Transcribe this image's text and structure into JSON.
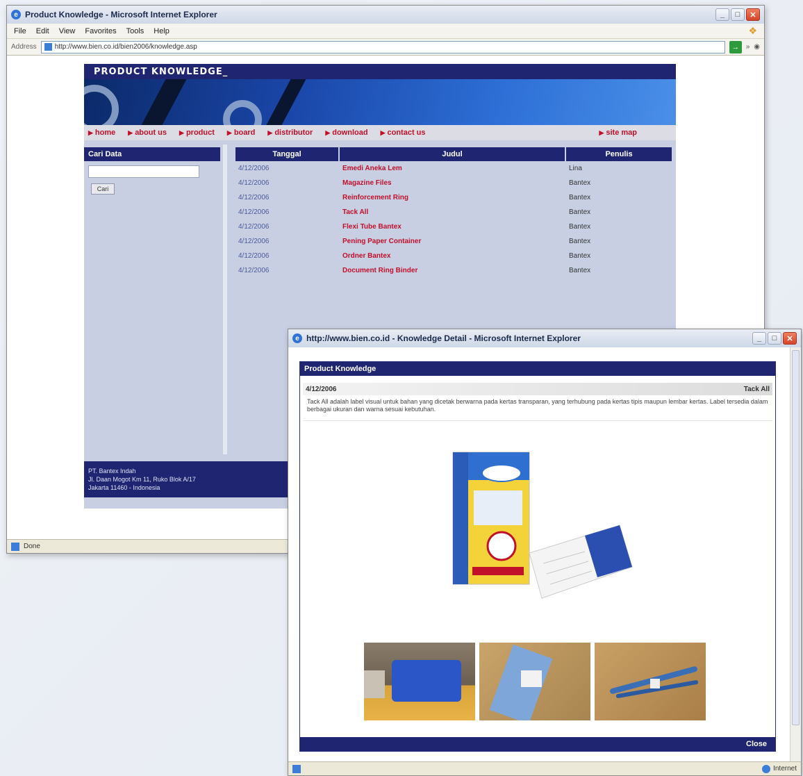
{
  "main_window": {
    "title": "Product Knowledge - Microsoft Internet Explorer",
    "menu": [
      "File",
      "Edit",
      "View",
      "Favorites",
      "Tools",
      "Help"
    ],
    "address_label": "Address",
    "address_url": "http://www.bien.co.id/bien2006/knowledge.asp",
    "status": "Done"
  },
  "site": {
    "header_title": "PRODUCT KNOWLEDGE_",
    "nav": [
      {
        "label": "home"
      },
      {
        "label": "about us"
      },
      {
        "label": "product"
      },
      {
        "label": "board"
      },
      {
        "label": "distributor"
      },
      {
        "label": "download"
      },
      {
        "label": "contact us"
      },
      {
        "label": "site map"
      }
    ],
    "search": {
      "title": "Cari Data",
      "placeholder": "",
      "button_label": "Cari"
    },
    "table": {
      "headers": [
        "Tanggal",
        "Judul",
        "Penulis"
      ],
      "rows": [
        {
          "date": "4/12/2006",
          "title": "Emedi Aneka Lem",
          "author": "Lina"
        },
        {
          "date": "4/12/2006",
          "title": "Magazine Files",
          "author": "Bantex"
        },
        {
          "date": "4/12/2006",
          "title": "Reinforcement Ring",
          "author": "Bantex"
        },
        {
          "date": "4/12/2006",
          "title": "Tack All",
          "author": "Bantex"
        },
        {
          "date": "4/12/2006",
          "title": "Flexi Tube Bantex",
          "author": "Bantex"
        },
        {
          "date": "4/12/2006",
          "title": "Pening Paper Container",
          "author": "Bantex"
        },
        {
          "date": "4/12/2006",
          "title": "Ordner Bantex",
          "author": "Bantex"
        },
        {
          "date": "4/12/2006",
          "title": "Document Ring Binder",
          "author": "Bantex"
        }
      ]
    },
    "footer": [
      "PT. Bantex Indah",
      "Jl. Daan Mogot Km 11, Ruko Blok A/17",
      "Jakarta 11460 - Indonesia"
    ]
  },
  "popup": {
    "title": "http://www.bien.co.id - Knowledge Detail - Microsoft Internet Explorer",
    "header": "Product Knowledge",
    "date": "4/12/2006",
    "product_title": "Tack All",
    "description": "Tack All adalah label visual untuk bahan yang dicetak berwarna pada kertas transparan, yang terhubung pada kertas tipis maupun lembar kertas. Label tersedia dalam berbagai ukuran dan warna sesuai kebutuhan.",
    "close_label": "Close",
    "status": "Internet"
  },
  "colors": {
    "navy": "#1f2571",
    "accent_red": "#c0102a",
    "panel_bg": "#c9cfe3"
  }
}
